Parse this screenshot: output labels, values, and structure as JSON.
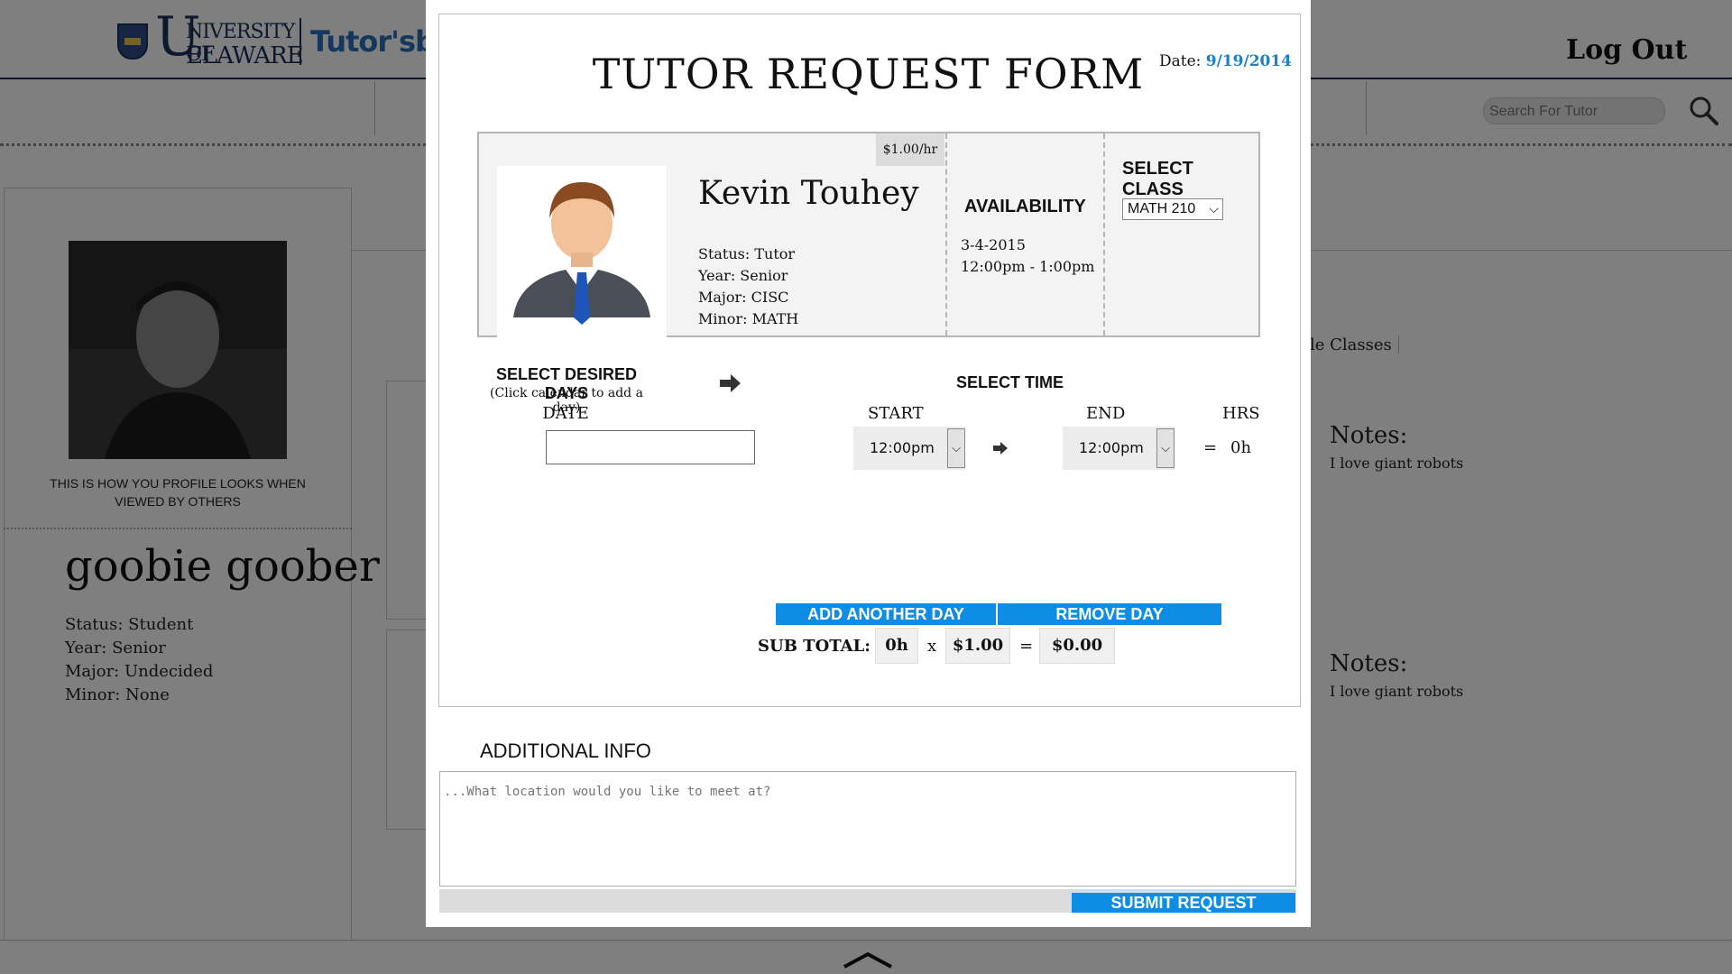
{
  "header": {
    "university_logo": {
      "big": "U",
      "line1": "NIVERSITY OF",
      "line2": "ELAWARE"
    },
    "brand_text": "Tutor'sbir",
    "logout_label": "Log Out",
    "search_placeholder": "Search For Tutor"
  },
  "profile": {
    "caption": "THIS IS HOW YOU PROFILE LOOKS WHEN VIEWED BY OTHERS",
    "name": "goobie goober",
    "status": "Status: Student",
    "year": "Year: Senior",
    "major": "Major: Undecided",
    "minor": "Minor: None"
  },
  "background_right": {
    "classes_label": "le Classes",
    "notes": [
      {
        "title": "Notes:",
        "text": "I love giant robots"
      },
      {
        "title": "Notes:",
        "text": "I love giant robots"
      }
    ]
  },
  "modal": {
    "title": "TUTOR REQUEST FORM",
    "date_label": "Date:",
    "date_value": "9/19/2014",
    "tutor": {
      "rate": "$1.00/hr",
      "name": "Kevin Touhey",
      "status": "Status: Tutor",
      "year": "Year: Senior",
      "major": "Major: CISC",
      "minor": "Minor: MATH"
    },
    "availability": {
      "title": "AVAILABILITY",
      "date": "3-4-2015",
      "time": "12:00pm - 1:00pm"
    },
    "select_class": {
      "title": "SELECT CLASS",
      "value": "MATH 210"
    },
    "days": {
      "title": "SELECT DESIRED DAYS",
      "hint": "(Click calendar to add a day)",
      "date_label": "DATE"
    },
    "time": {
      "title": "SELECT TIME",
      "start_label": "START",
      "end_label": "END",
      "hrs_label": "HRS",
      "start_value": "12:00pm",
      "end_value": "12:00pm",
      "equals": "=",
      "hrs_value": "0h"
    },
    "buttons": {
      "add_day": "ADD ANOTHER DAY",
      "remove_day": "REMOVE DAY",
      "submit": "SUBMIT REQUEST"
    },
    "subtotal": {
      "label": "SUB TOTAL:",
      "hours": "0h",
      "times": "x",
      "rate": "$1.00",
      "equals": "=",
      "total": "$0.00"
    },
    "additional_info": {
      "title": "ADDITIONAL INFO",
      "placeholder": "...What location would you like to meet at?"
    }
  },
  "colors": {
    "accent_blue": "#0d8de4",
    "date_blue": "#1f7fc8",
    "ud_navy": "#1a2f5a"
  }
}
